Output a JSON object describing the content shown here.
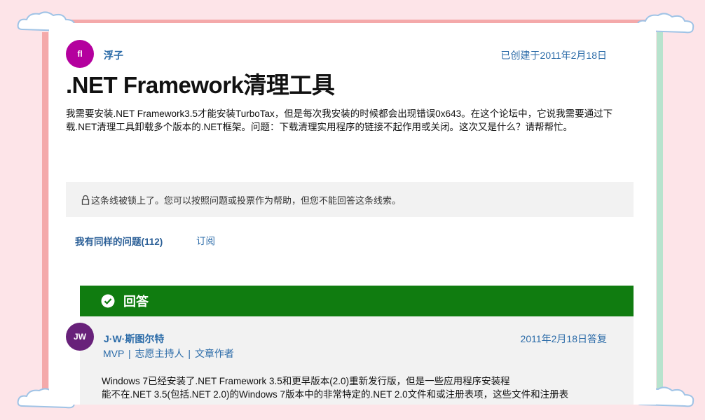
{
  "question": {
    "author_initials": "fl",
    "author_name": "浮子",
    "created": "已创建于2011年2月18日",
    "title": ".NET Framework清理工具",
    "body": "我需要安装.NET Framework3.5才能安装TurboTax，但是每次我安装的时候都会出现错误0x643。在这个论坛中，它说我需要通过下载.NET清理工具卸载多个版本的.NET框架。问题：下载清理实用程序的链接不起作用或关闭。这次又是什么？请帮帮忙。",
    "locked_notice": "这条线被锁上了。您可以按照问题或投票作为帮助，但您不能回答这条线索。",
    "same_question_label": "我有同样的问题(112)",
    "subscribe_label": "订阅"
  },
  "answer": {
    "header_label": "回答",
    "author_initials": "JW",
    "author_name": "J·W·斯图尔特",
    "replied": "2011年2月18日答复",
    "roles": [
      "MVP",
      "志愿主持人",
      "文章作者"
    ],
    "role_separator": "|",
    "body_line1": "Windows 7已经安装了.NET Framework 3.5和更早版本(2.0)重新发行版，但是一些应用程序安装程",
    "body_line2": "能不在.NET 3.5(包括.NET 2.0)的Windows 7版本中的非常特定的.NET 2.0文件和或注册表项，这些文件和注册表"
  },
  "colors": {
    "link": "#2b6ba8",
    "answer_green": "#107c10",
    "avatar_question": "#b4009e",
    "avatar_answer": "#68217a",
    "frame_pink": "#f4a9aa",
    "frame_green": "#b7e3cd",
    "background": "#fde4e8"
  }
}
